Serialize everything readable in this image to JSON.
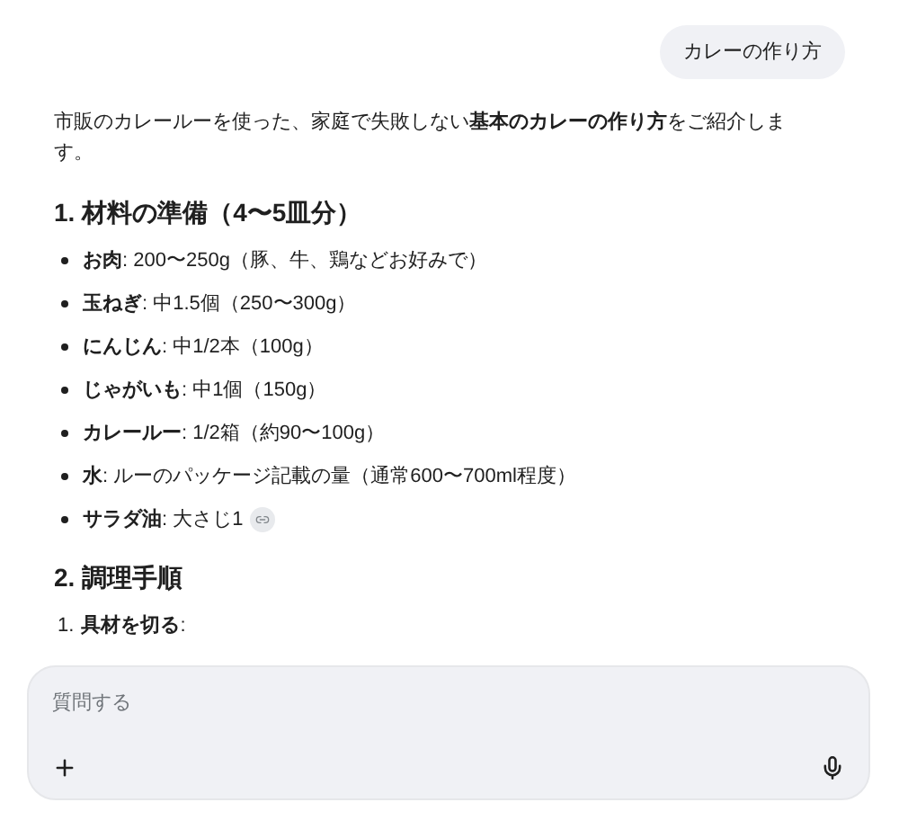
{
  "user_message": "カレーの作り方",
  "intro": "市販のカレールーを使った、家庭で失敗しない**基本のカレーの作り方**をご紹介します。",
  "sections": [
    {
      "heading": "1. 材料の準備（4〜5皿分）",
      "kind": "bullets",
      "items": [
        {
          "label": "お肉",
          "text": ": 200〜250g（豚、牛、鶏などお好みで）",
          "source_chip": false
        },
        {
          "label": "玉ねぎ",
          "text": ": 中1.5個（250〜300g）",
          "source_chip": false
        },
        {
          "label": "にんじん",
          "text": ": 中1/2本（100g）",
          "source_chip": false
        },
        {
          "label": "じゃがいも",
          "text": ": 中1個（150g）",
          "source_chip": false
        },
        {
          "label": "カレールー",
          "text": ": 1/2箱（約90〜100g）",
          "source_chip": false
        },
        {
          "label": "水",
          "text": ": ルーのパッケージ記載の量（通常600〜700ml程度）",
          "source_chip": false
        },
        {
          "label": "サラダ油",
          "text": ": 大さじ1",
          "source_chip": true
        }
      ]
    },
    {
      "heading": "2. 調理手順",
      "kind": "numbered",
      "items": [
        {
          "number": "1.",
          "label": "具材を切る",
          "text": ":",
          "source_chip": false
        }
      ]
    }
  ],
  "composer": {
    "placeholder": "質問する"
  }
}
